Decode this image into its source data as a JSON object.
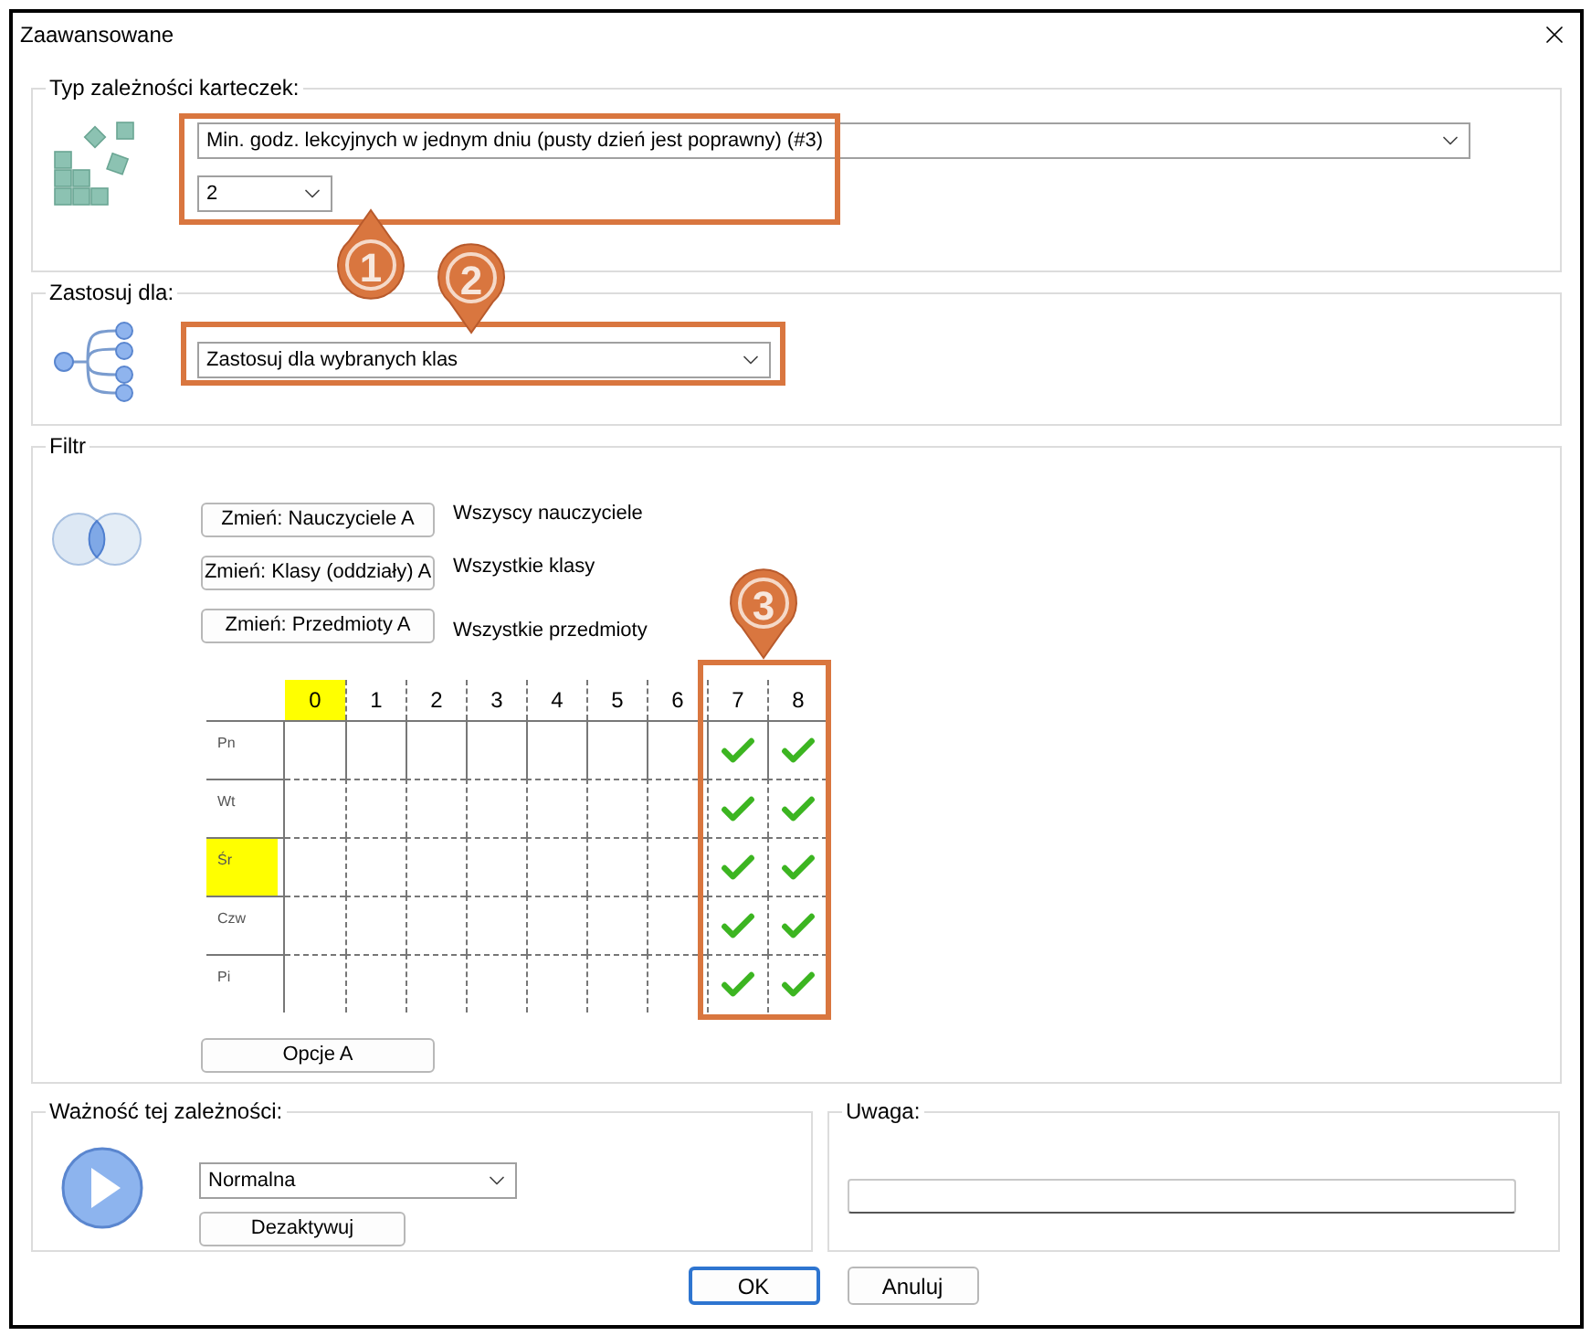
{
  "window": {
    "title": "Zaawansowane"
  },
  "type_group": {
    "legend": "Typ zależności karteczek:",
    "rule_select": {
      "value": "Min. godz. lekcyjnych w jednym dniu (pusty dzień jest poprawny) (#3)"
    },
    "count_select": {
      "value": "2"
    }
  },
  "apply_group": {
    "legend": "Zastosuj dla:",
    "select": {
      "value": "Zastosuj dla wybranych klas"
    }
  },
  "filter_group": {
    "legend": "Filtr",
    "filters": [
      {
        "button": "Zmień: Nauczyciele A",
        "value": "Wszyscy nauczyciele"
      },
      {
        "button": "Zmień: Klasy (oddziały) A",
        "value": "Wszystkie klasy"
      },
      {
        "button": "Zmień: Przedmioty A",
        "value": "Wszystkie przedmioty"
      }
    ],
    "grid": {
      "columns": [
        {
          "label": "0",
          "highlighted": true
        },
        {
          "label": "1",
          "highlighted": false
        },
        {
          "label": "2",
          "highlighted": false
        },
        {
          "label": "3",
          "highlighted": false
        },
        {
          "label": "4",
          "highlighted": false
        },
        {
          "label": "5",
          "highlighted": false
        },
        {
          "label": "6",
          "highlighted": false
        },
        {
          "label": "7",
          "highlighted": false
        },
        {
          "label": "8",
          "highlighted": false
        }
      ],
      "rows": [
        {
          "label": "Pn",
          "highlighted": false,
          "cells": [
            false,
            false,
            false,
            false,
            false,
            false,
            false,
            true,
            true
          ]
        },
        {
          "label": "Wt",
          "highlighted": false,
          "cells": [
            false,
            false,
            false,
            false,
            false,
            false,
            false,
            true,
            true
          ]
        },
        {
          "label": "Śr",
          "highlighted": true,
          "cells": [
            false,
            false,
            false,
            false,
            false,
            false,
            false,
            true,
            true
          ]
        },
        {
          "label": "Czw",
          "highlighted": false,
          "cells": [
            false,
            false,
            false,
            false,
            false,
            false,
            false,
            true,
            true
          ]
        },
        {
          "label": "Pi",
          "highlighted": false,
          "cells": [
            false,
            false,
            false,
            false,
            false,
            false,
            false,
            true,
            true
          ]
        }
      ]
    },
    "options_button": "Opcje A"
  },
  "importance_group": {
    "legend": "Ważność tej zależności:",
    "select": {
      "value": "Normalna"
    },
    "button": "Dezaktywuj"
  },
  "note_group": {
    "legend": "Uwaga:"
  },
  "buttons": [
    {
      "label": "OK",
      "default": true
    },
    {
      "label": "Anuluj",
      "default": false
    }
  ],
  "callouts": [
    {
      "number": "1"
    },
    {
      "number": "2"
    },
    {
      "number": "3"
    }
  ]
}
